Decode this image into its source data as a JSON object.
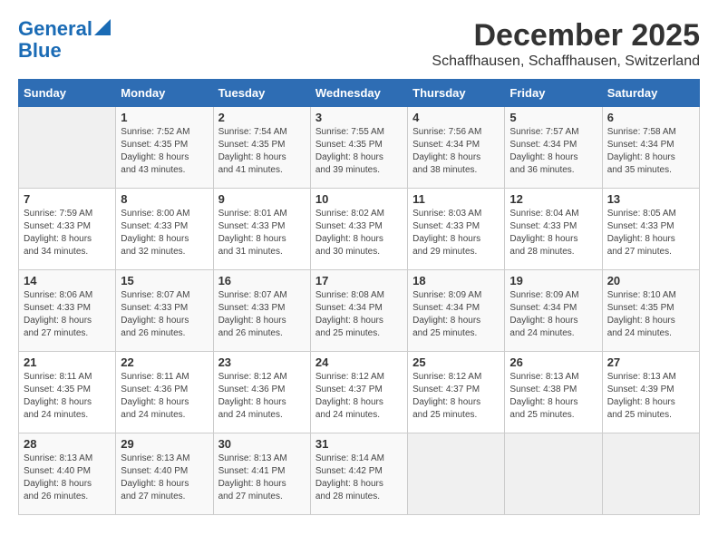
{
  "header": {
    "logo_line1": "General",
    "logo_line2": "Blue",
    "month": "December 2025",
    "location": "Schaffhausen, Schaffhausen, Switzerland"
  },
  "days_of_week": [
    "Sunday",
    "Monday",
    "Tuesday",
    "Wednesday",
    "Thursday",
    "Friday",
    "Saturday"
  ],
  "weeks": [
    [
      {
        "day": "",
        "info": ""
      },
      {
        "day": "1",
        "info": "Sunrise: 7:52 AM\nSunset: 4:35 PM\nDaylight: 8 hours\nand 43 minutes."
      },
      {
        "day": "2",
        "info": "Sunrise: 7:54 AM\nSunset: 4:35 PM\nDaylight: 8 hours\nand 41 minutes."
      },
      {
        "day": "3",
        "info": "Sunrise: 7:55 AM\nSunset: 4:35 PM\nDaylight: 8 hours\nand 39 minutes."
      },
      {
        "day": "4",
        "info": "Sunrise: 7:56 AM\nSunset: 4:34 PM\nDaylight: 8 hours\nand 38 minutes."
      },
      {
        "day": "5",
        "info": "Sunrise: 7:57 AM\nSunset: 4:34 PM\nDaylight: 8 hours\nand 36 minutes."
      },
      {
        "day": "6",
        "info": "Sunrise: 7:58 AM\nSunset: 4:34 PM\nDaylight: 8 hours\nand 35 minutes."
      }
    ],
    [
      {
        "day": "7",
        "info": "Sunrise: 7:59 AM\nSunset: 4:33 PM\nDaylight: 8 hours\nand 34 minutes."
      },
      {
        "day": "8",
        "info": "Sunrise: 8:00 AM\nSunset: 4:33 PM\nDaylight: 8 hours\nand 32 minutes."
      },
      {
        "day": "9",
        "info": "Sunrise: 8:01 AM\nSunset: 4:33 PM\nDaylight: 8 hours\nand 31 minutes."
      },
      {
        "day": "10",
        "info": "Sunrise: 8:02 AM\nSunset: 4:33 PM\nDaylight: 8 hours\nand 30 minutes."
      },
      {
        "day": "11",
        "info": "Sunrise: 8:03 AM\nSunset: 4:33 PM\nDaylight: 8 hours\nand 29 minutes."
      },
      {
        "day": "12",
        "info": "Sunrise: 8:04 AM\nSunset: 4:33 PM\nDaylight: 8 hours\nand 28 minutes."
      },
      {
        "day": "13",
        "info": "Sunrise: 8:05 AM\nSunset: 4:33 PM\nDaylight: 8 hours\nand 27 minutes."
      }
    ],
    [
      {
        "day": "14",
        "info": "Sunrise: 8:06 AM\nSunset: 4:33 PM\nDaylight: 8 hours\nand 27 minutes."
      },
      {
        "day": "15",
        "info": "Sunrise: 8:07 AM\nSunset: 4:33 PM\nDaylight: 8 hours\nand 26 minutes."
      },
      {
        "day": "16",
        "info": "Sunrise: 8:07 AM\nSunset: 4:33 PM\nDaylight: 8 hours\nand 26 minutes."
      },
      {
        "day": "17",
        "info": "Sunrise: 8:08 AM\nSunset: 4:34 PM\nDaylight: 8 hours\nand 25 minutes."
      },
      {
        "day": "18",
        "info": "Sunrise: 8:09 AM\nSunset: 4:34 PM\nDaylight: 8 hours\nand 25 minutes."
      },
      {
        "day": "19",
        "info": "Sunrise: 8:09 AM\nSunset: 4:34 PM\nDaylight: 8 hours\nand 24 minutes."
      },
      {
        "day": "20",
        "info": "Sunrise: 8:10 AM\nSunset: 4:35 PM\nDaylight: 8 hours\nand 24 minutes."
      }
    ],
    [
      {
        "day": "21",
        "info": "Sunrise: 8:11 AM\nSunset: 4:35 PM\nDaylight: 8 hours\nand 24 minutes."
      },
      {
        "day": "22",
        "info": "Sunrise: 8:11 AM\nSunset: 4:36 PM\nDaylight: 8 hours\nand 24 minutes."
      },
      {
        "day": "23",
        "info": "Sunrise: 8:12 AM\nSunset: 4:36 PM\nDaylight: 8 hours\nand 24 minutes."
      },
      {
        "day": "24",
        "info": "Sunrise: 8:12 AM\nSunset: 4:37 PM\nDaylight: 8 hours\nand 24 minutes."
      },
      {
        "day": "25",
        "info": "Sunrise: 8:12 AM\nSunset: 4:37 PM\nDaylight: 8 hours\nand 25 minutes."
      },
      {
        "day": "26",
        "info": "Sunrise: 8:13 AM\nSunset: 4:38 PM\nDaylight: 8 hours\nand 25 minutes."
      },
      {
        "day": "27",
        "info": "Sunrise: 8:13 AM\nSunset: 4:39 PM\nDaylight: 8 hours\nand 25 minutes."
      }
    ],
    [
      {
        "day": "28",
        "info": "Sunrise: 8:13 AM\nSunset: 4:40 PM\nDaylight: 8 hours\nand 26 minutes."
      },
      {
        "day": "29",
        "info": "Sunrise: 8:13 AM\nSunset: 4:40 PM\nDaylight: 8 hours\nand 27 minutes."
      },
      {
        "day": "30",
        "info": "Sunrise: 8:13 AM\nSunset: 4:41 PM\nDaylight: 8 hours\nand 27 minutes."
      },
      {
        "day": "31",
        "info": "Sunrise: 8:14 AM\nSunset: 4:42 PM\nDaylight: 8 hours\nand 28 minutes."
      },
      {
        "day": "",
        "info": ""
      },
      {
        "day": "",
        "info": ""
      },
      {
        "day": "",
        "info": ""
      }
    ]
  ]
}
